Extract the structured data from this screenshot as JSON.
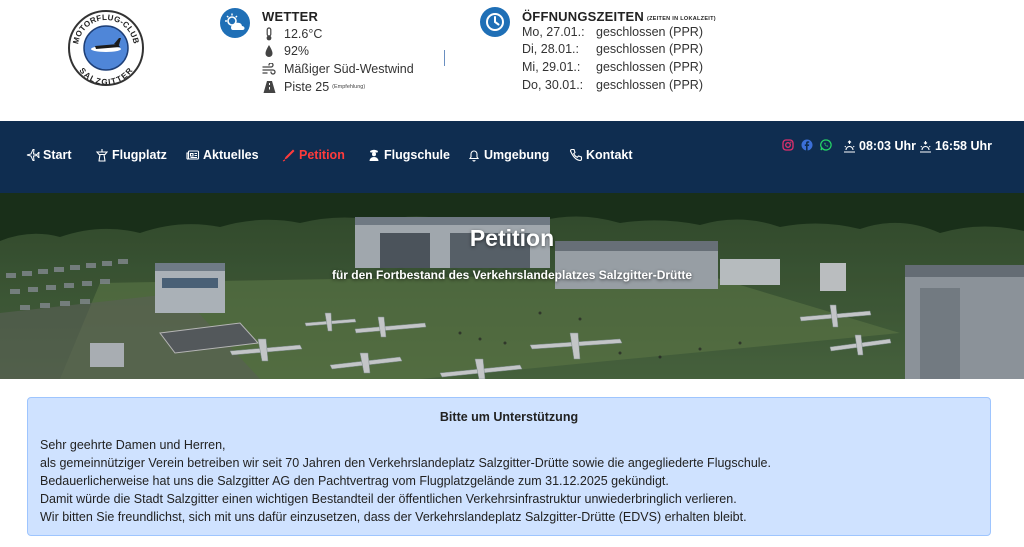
{
  "logo": {
    "top_text": "MOTORFLUG-CLUB",
    "bottom_text": "SALZGITTER"
  },
  "weather": {
    "title": "WETTER",
    "temperature": "12.6°C",
    "humidity": "92%",
    "wind": "Mäßiger Süd-Westwind",
    "runway": "Piste 25",
    "runway_note": "(Empfehlung)"
  },
  "hours": {
    "title": "ÖFFNUNGSZEITEN",
    "note": "(ZEITEN IN LOKALZEIT)",
    "rows": [
      {
        "day": "Mo, 27.01.:",
        "status": "geschlossen (PPR)"
      },
      {
        "day": "Di, 28.01.:",
        "status": "geschlossen (PPR)"
      },
      {
        "day": "Mi, 29.01.:",
        "status": "geschlossen (PPR)"
      },
      {
        "day": "Do, 30.01.:",
        "status": "geschlossen (PPR)"
      }
    ]
  },
  "nav": {
    "items": [
      {
        "label": "Start",
        "icon": "plane-icon"
      },
      {
        "label": "Flugplatz",
        "icon": "tower-icon"
      },
      {
        "label": "Aktuelles",
        "icon": "newspaper-icon"
      },
      {
        "label": "Petition",
        "icon": "pen-icon",
        "active": true
      },
      {
        "label": "Flugschule",
        "icon": "pilot-icon"
      },
      {
        "label": "Umgebung",
        "icon": "bell-icon"
      },
      {
        "label": "Kontakt",
        "icon": "phone-icon"
      }
    ],
    "social": [
      "instagram-icon",
      "facebook-icon",
      "whatsapp-icon"
    ],
    "sunrise": "08:03 Uhr",
    "sunset": "16:58 Uhr"
  },
  "hero": {
    "title": "Petition",
    "subtitle": "für den Fortbestand des Verkehrslandeplatzes Salzgitter-Drütte"
  },
  "info": {
    "heading": "Bitte um Unterstützung",
    "lines": [
      "Sehr geehrte Damen und Herren,",
      "als gemeinnütziger Verein betreiben wir seit 70 Jahren den Verkehrslandeplatz Salzgitter-Drütte sowie die angegliederte Flugschule.",
      "Bedauerlicherweise hat uns die Salzgitter AG den Pachtvertrag vom Flugplatzgelände zum 31.12.2025 gekündigt.",
      "Damit würde die Stadt Salzgitter einen wichtigen Bestandteil der öffentlichen Verkehrsinfrastruktur unwiederbringlich verlieren.",
      "Wir bitten Sie freundlichst, sich mit uns dafür einzusetzen, dass der Verkehrslandeplatz Salzgitter-Drütte (EDVS) erhalten bleibt."
    ]
  },
  "colors": {
    "nav_bg": "#0f2d50",
    "accent": "#1f6fb6",
    "active": "#ff3b3b",
    "info_bg": "#cfe2ff",
    "info_border": "#9ec5fe"
  }
}
